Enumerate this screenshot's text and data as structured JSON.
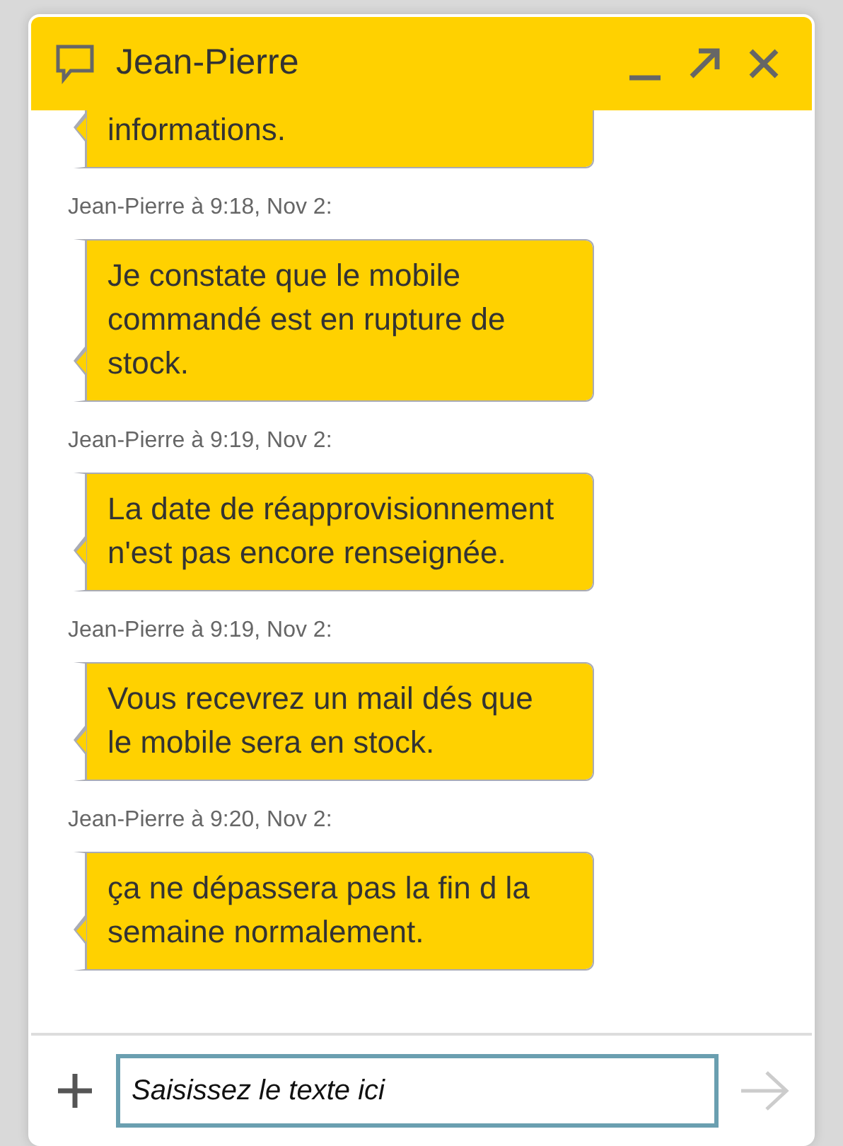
{
  "window": {
    "title": "Jean-Pierre"
  },
  "messages": [
    {
      "text": "informations."
    },
    {
      "sender_line": "Jean-Pierre à 9:18, Nov 2:",
      "text": "Je constate que le mobile commandé est en rupture de stock."
    },
    {
      "sender_line": "Jean-Pierre à 9:19, Nov 2:",
      "text": "La date de réapprovisionnement n'est pas encore renseignée."
    },
    {
      "sender_line": "Jean-Pierre à 9:19, Nov 2:",
      "text": "Vous recevrez un mail dés que le mobile sera en stock."
    },
    {
      "sender_line": "Jean-Pierre à 9:20, Nov 2:",
      "text": "ça ne dépassera pas la fin d la semaine normalement."
    }
  ],
  "composer": {
    "placeholder": "Saisissez le texte ici"
  }
}
